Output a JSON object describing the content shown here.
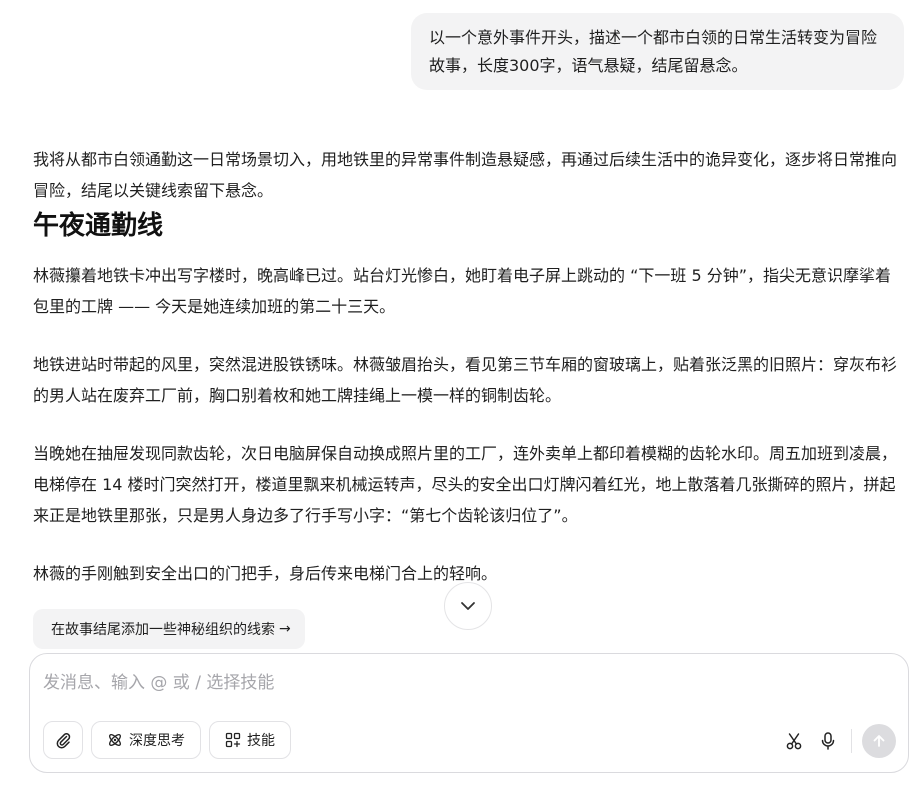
{
  "conversation": {
    "user_message": "以一个意外事件开头，描述一个都市白领的日常生活转变为冒险故事，长度300字，语气悬疑，结尾留悬念。",
    "reply": {
      "intro": "我将从都市白领通勤这一日常场景切入，用地铁里的异常事件制造悬疑感，再通过后续生活中的诡异变化，逐步将日常推向冒险，结尾以关键线索留下悬念。",
      "title": "午夜通勤线",
      "paragraphs": [
        "林薇攥着地铁卡冲出写字楼时，晚高峰已过。站台灯光惨白，她盯着电子屏上跳动的 “下一班 5 分钟”，指尖无意识摩挲着包里的工牌 —— 今天是她连续加班的第二十三天。",
        "地铁进站时带起的风里，突然混进股铁锈味。林薇皱眉抬头，看见第三节车厢的窗玻璃上，贴着张泛黑的旧照片：穿灰布衫的男人站在废弃工厂前，胸口别着枚和她工牌挂绳上一模一样的铜制齿轮。",
        "当晚她在抽屉发现同款齿轮，次日电脑屏保自动换成照片里的工厂，连外卖单上都印着模糊的齿轮水印。周五加班到凌晨，电梯停在 14 楼时门突然打开，楼道里飘来机械运转声，尽头的安全出口灯牌闪着红光，地上散落着几张撕碎的照片，拼起来正是地铁里那张，只是男人身边多了行手写小字：“第七个齿轮该归位了”。",
        "林薇的手刚触到安全出口的门把手，身后传来电梯门合上的轻响。"
      ]
    },
    "suggestion": "在故事结尾添加一些神秘组织的线索",
    "suggestion_arrow": "→"
  },
  "composer": {
    "placeholder": "发消息、输入 @ 或 / 选择技能",
    "buttons": {
      "deep_think": "深度思考",
      "skills": "技能"
    },
    "icons": {
      "attach": "paperclip-icon",
      "deep_think": "atom-icon",
      "skills": "grid-icon",
      "scissors": "scissors-icon",
      "mic": "microphone-icon",
      "send": "arrow-up-icon",
      "scroll": "chevron-down-icon"
    }
  },
  "colors": {
    "bubble_bg": "#f3f3f4",
    "placeholder": "#a6a6ab",
    "send_disabled": "#dcdcdf"
  }
}
